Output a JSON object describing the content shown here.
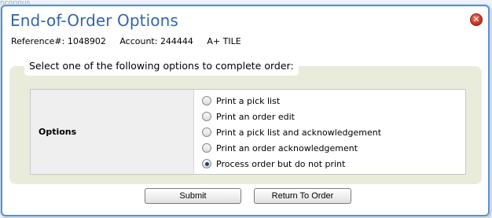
{
  "background": {
    "corner_text": "ncorious"
  },
  "dialog": {
    "title": "End-of-Order Options",
    "reference_label": "Reference#:",
    "reference_value": "1048902",
    "account_label": "Account:",
    "account_value": "244444",
    "account_name": "A+ TILE",
    "close_icon": "close-icon",
    "prompt": "Select one of the following options to complete order:",
    "options_label": "Options",
    "options": [
      {
        "label": "Print a pick list",
        "checked": false
      },
      {
        "label": "Print an order edit",
        "checked": false
      },
      {
        "label": "Print a pick list and acknowledgement",
        "checked": false
      },
      {
        "label": "Print an order acknowledgement",
        "checked": false
      },
      {
        "label": "Process order but do not print",
        "checked": true
      }
    ],
    "submit_label": "Submit",
    "return_label": "Return To Order"
  },
  "colors": {
    "title": "#3465a4",
    "border": "#5b8fc7",
    "panel": "#e9ecdb",
    "close": "#d0321e"
  }
}
